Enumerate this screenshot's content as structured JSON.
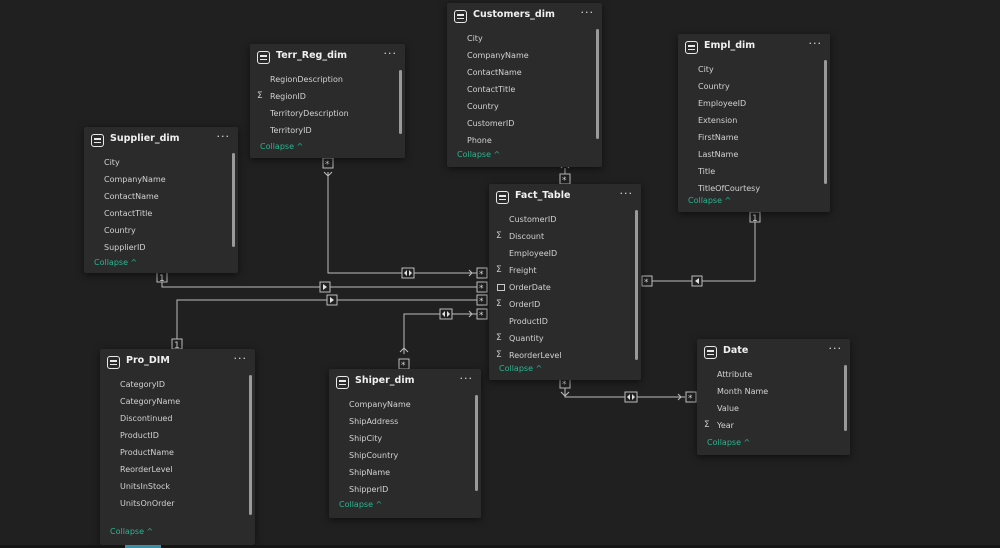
{
  "collapse_label": "Collapse",
  "more_label": "···",
  "colors": {
    "background": "#202020",
    "card": "#2b2b2b",
    "accent": "#2ab58f",
    "line": "#bdbdbd"
  },
  "tables": [
    {
      "key": "customers",
      "title": "Customers_dim",
      "fields": [
        {
          "name": "City"
        },
        {
          "name": "CompanyName"
        },
        {
          "name": "ContactName"
        },
        {
          "name": "ContactTitle"
        },
        {
          "name": "Country"
        },
        {
          "name": "CustomerID"
        },
        {
          "name": "Phone"
        }
      ]
    },
    {
      "key": "terr",
      "title": "Terr_Reg_dim",
      "fields": [
        {
          "name": "RegionDescription"
        },
        {
          "name": "RegionID",
          "icon": "sigma"
        },
        {
          "name": "TerritoryDescription"
        },
        {
          "name": "TerritoryID"
        }
      ]
    },
    {
      "key": "empl",
      "title": "Empl_dim",
      "fields": [
        {
          "name": "City"
        },
        {
          "name": "Country"
        },
        {
          "name": "EmployeeID"
        },
        {
          "name": "Extension"
        },
        {
          "name": "FirstName"
        },
        {
          "name": "LastName"
        },
        {
          "name": "Title"
        },
        {
          "name": "TitleOfCourtesy"
        }
      ]
    },
    {
      "key": "supplier",
      "title": "Supplier_dim",
      "fields": [
        {
          "name": "City"
        },
        {
          "name": "CompanyName"
        },
        {
          "name": "ContactName"
        },
        {
          "name": "ContactTitle"
        },
        {
          "name": "Country"
        },
        {
          "name": "SupplierID"
        }
      ]
    },
    {
      "key": "fact",
      "title": "Fact_Table",
      "fields": [
        {
          "name": "CustomerID"
        },
        {
          "name": "Discount",
          "icon": "sigma"
        },
        {
          "name": "EmployeeID"
        },
        {
          "name": "Freight",
          "icon": "sigma"
        },
        {
          "name": "OrderDate",
          "icon": "calendar"
        },
        {
          "name": "OrderID",
          "icon": "sigma"
        },
        {
          "name": "ProductID"
        },
        {
          "name": "Quantity",
          "icon": "sigma"
        },
        {
          "name": "ReorderLevel",
          "icon": "sigma"
        }
      ]
    },
    {
      "key": "pro",
      "title": "Pro_DIM",
      "fields": [
        {
          "name": "CategoryID"
        },
        {
          "name": "CategoryName"
        },
        {
          "name": "Discontinued"
        },
        {
          "name": "ProductID"
        },
        {
          "name": "ProductName"
        },
        {
          "name": "ReorderLevel"
        },
        {
          "name": "UnitsInStock"
        },
        {
          "name": "UnitsOnOrder"
        }
      ]
    },
    {
      "key": "shiper",
      "title": "Shiper_dim",
      "fields": [
        {
          "name": "CompanyName"
        },
        {
          "name": "ShipAddress"
        },
        {
          "name": "ShipCity"
        },
        {
          "name": "ShipCountry"
        },
        {
          "name": "ShipName"
        },
        {
          "name": "ShipperID"
        }
      ]
    },
    {
      "key": "date",
      "title": "Date",
      "fields": [
        {
          "name": "Attribute"
        },
        {
          "name": "Month Name"
        },
        {
          "name": "Value"
        },
        {
          "name": "Year",
          "icon": "sigma"
        }
      ]
    }
  ],
  "relationships": [
    {
      "from": "Terr_Reg_dim",
      "to": "Fact_Table",
      "from_card": "*",
      "to_card": "*",
      "direction": "both"
    },
    {
      "from": "Supplier_dim",
      "to": "Fact_Table",
      "from_card": "1",
      "to_card": "*",
      "direction": "single"
    },
    {
      "from": "Pro_DIM",
      "to": "Fact_Table",
      "from_card": "1",
      "to_card": "*",
      "direction": "single"
    },
    {
      "from": "Shiper_dim",
      "to": "Fact_Table",
      "from_card": "*",
      "to_card": "*",
      "direction": "both"
    },
    {
      "from": "Customers_dim",
      "to": "Fact_Table",
      "from_card": "*",
      "to_card": "*",
      "direction": "single"
    },
    {
      "from": "Empl_dim",
      "to": "Fact_Table",
      "from_card": "1",
      "to_card": "*",
      "direction": "single"
    },
    {
      "from": "Fact_Table",
      "to": "Date",
      "from_card": "*",
      "to_card": "*",
      "direction": "both"
    }
  ]
}
